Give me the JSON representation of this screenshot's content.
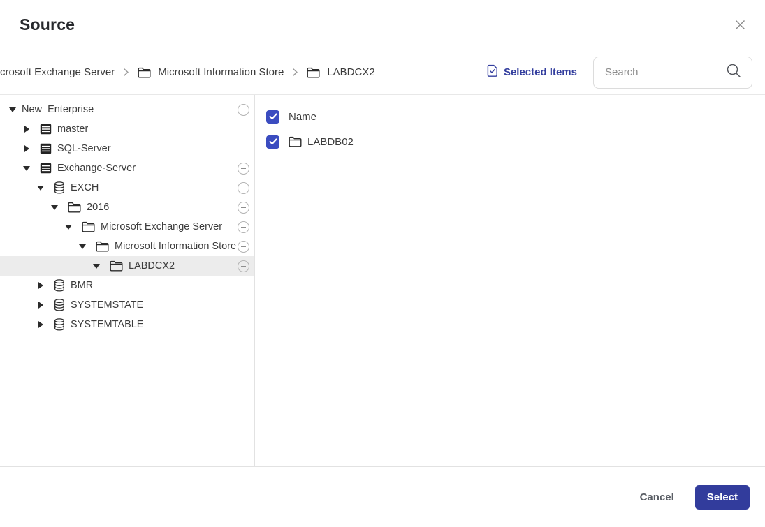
{
  "dialog": {
    "title": "Source"
  },
  "breadcrumb": {
    "items": [
      {
        "label": "crosoft Exchange Server"
      },
      {
        "label": "Microsoft Information Store"
      },
      {
        "label": "LABDCX2"
      }
    ]
  },
  "toolbar": {
    "selected_items_label": "Selected Items",
    "search_placeholder": "Search",
    "search_value": ""
  },
  "tree": {
    "items": [
      {
        "label": "New_Enterprise",
        "level": 0,
        "expanded": true,
        "icon": "none",
        "removable": true,
        "selected": false
      },
      {
        "label": "master",
        "level": 1,
        "expanded": false,
        "icon": "server",
        "removable": false,
        "selected": false
      },
      {
        "label": "SQL-Server",
        "level": 1,
        "expanded": false,
        "icon": "server",
        "removable": false,
        "selected": false
      },
      {
        "label": "Exchange-Server",
        "level": 1,
        "expanded": true,
        "icon": "server",
        "removable": true,
        "selected": false
      },
      {
        "label": "EXCH",
        "level": 2,
        "expanded": true,
        "icon": "database",
        "removable": true,
        "selected": false
      },
      {
        "label": "2016",
        "level": 3,
        "expanded": true,
        "icon": "folder",
        "removable": true,
        "selected": false
      },
      {
        "label": "Microsoft Exchange Server",
        "level": 4,
        "expanded": true,
        "icon": "folder",
        "removable": true,
        "selected": false
      },
      {
        "label": "Microsoft Information Store",
        "level": 5,
        "expanded": true,
        "icon": "folder",
        "removable": true,
        "selected": false
      },
      {
        "label": "LABDCX2",
        "level": 6,
        "expanded": true,
        "icon": "folder",
        "removable": true,
        "selected": true
      },
      {
        "label": "BMR",
        "level": 2,
        "expanded": false,
        "icon": "database",
        "removable": false,
        "selected": false
      },
      {
        "label": "SYSTEMSTATE",
        "level": 2,
        "expanded": false,
        "icon": "database",
        "removable": false,
        "selected": false
      },
      {
        "label": "SYSTEMTABLE",
        "level": 2,
        "expanded": false,
        "icon": "database",
        "removable": false,
        "selected": false
      }
    ]
  },
  "content": {
    "header": {
      "label": "Name",
      "checked": true
    },
    "rows": [
      {
        "label": "LABDB02",
        "icon": "folder",
        "checked": true
      }
    ]
  },
  "footer": {
    "cancel_label": "Cancel",
    "select_label": "Select"
  },
  "colors": {
    "accent": "#333e9e",
    "button": "#323c9c",
    "checkbox": "#3b4cc0",
    "selected_row_bg": "#ececec",
    "divider": "#e5e5e5"
  }
}
